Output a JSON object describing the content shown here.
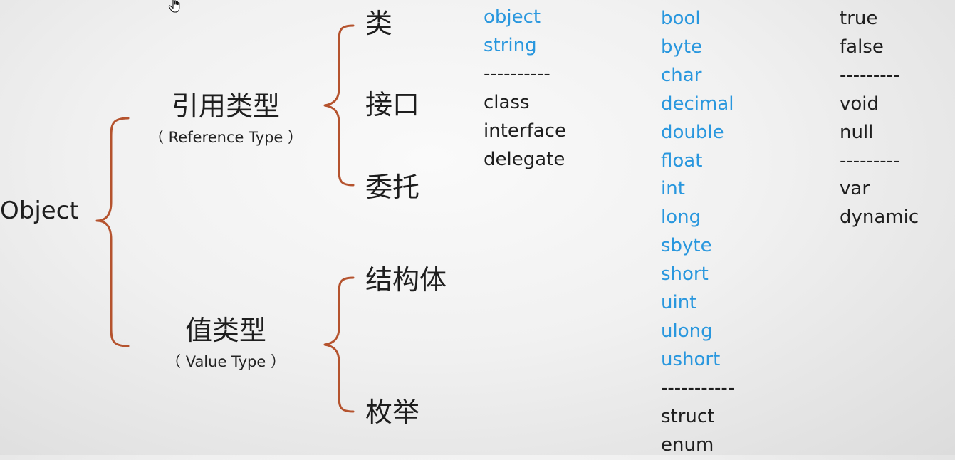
{
  "diagram": {
    "root": "Object",
    "reference": {
      "title": "引用类型",
      "subtitle": "（ Reference Type ）",
      "children": [
        "类",
        "接口",
        "委托"
      ]
    },
    "value": {
      "title": "值类型",
      "subtitle": "（ Value Type ）",
      "children": [
        "结构体",
        "枚举"
      ]
    },
    "brace_color": "#b5532e",
    "keyword_color": "#2997de"
  },
  "columns": {
    "col1": [
      {
        "text": "object",
        "style": "blue"
      },
      {
        "text": "string",
        "style": "blue"
      },
      {
        "text": "----------",
        "style": "dark"
      },
      {
        "text": "class",
        "style": "dark"
      },
      {
        "text": "interface",
        "style": "dark"
      },
      {
        "text": "delegate",
        "style": "dark"
      }
    ],
    "col2": [
      {
        "text": "bool",
        "style": "blue"
      },
      {
        "text": "byte",
        "style": "blue"
      },
      {
        "text": "char",
        "style": "blue"
      },
      {
        "text": "decimal",
        "style": "blue"
      },
      {
        "text": "double",
        "style": "blue"
      },
      {
        "text": "float",
        "style": "blue"
      },
      {
        "text": "int",
        "style": "blue"
      },
      {
        "text": "long",
        "style": "blue"
      },
      {
        "text": "sbyte",
        "style": "blue"
      },
      {
        "text": "short",
        "style": "blue"
      },
      {
        "text": "uint",
        "style": "blue"
      },
      {
        "text": "ulong",
        "style": "blue"
      },
      {
        "text": "ushort",
        "style": "blue"
      },
      {
        "text": "-----------",
        "style": "dark"
      },
      {
        "text": "struct",
        "style": "dark"
      },
      {
        "text": "enum",
        "style": "dark"
      }
    ],
    "col3": [
      {
        "text": "true",
        "style": "dark"
      },
      {
        "text": "false",
        "style": "dark"
      },
      {
        "text": "---------",
        "style": "dark"
      },
      {
        "text": "void",
        "style": "dark"
      },
      {
        "text": "null",
        "style": "dark"
      },
      {
        "text": "---------",
        "style": "dark"
      },
      {
        "text": "var",
        "style": "dark"
      },
      {
        "text": "dynamic",
        "style": "dark"
      }
    ]
  },
  "cursor": {
    "icon": "hand-pointer-icon"
  }
}
